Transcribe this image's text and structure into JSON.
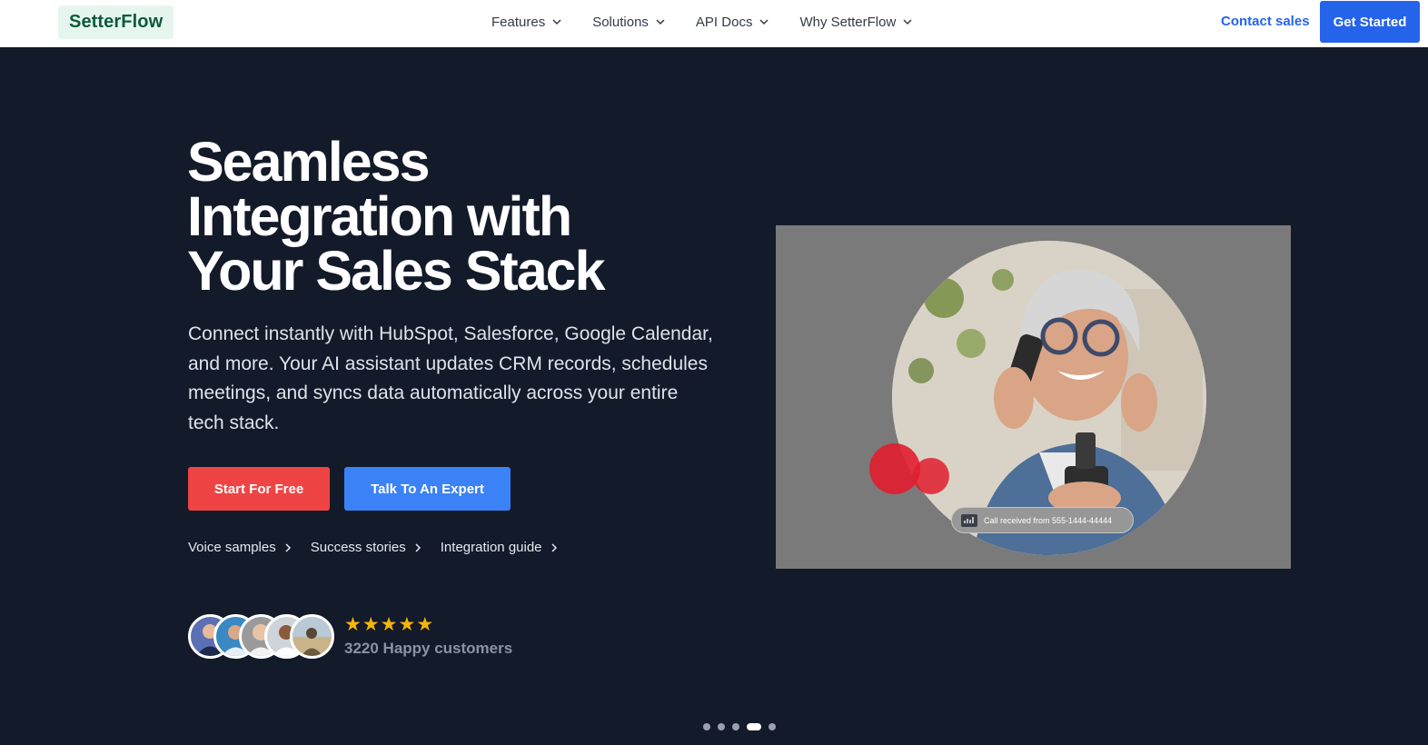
{
  "nav": {
    "logo": "SetterFlow",
    "menu": [
      {
        "label": "Features"
      },
      {
        "label": "Solutions"
      },
      {
        "label": "API Docs"
      },
      {
        "label": "Why SetterFlow"
      }
    ],
    "contact_label": "Contact sales",
    "cta_label": "Get Started"
  },
  "hero": {
    "headline_line1": "Seamless",
    "headline_line2": "Integration with",
    "headline_line3": "Your Sales Stack",
    "subtext": "Connect instantly with HubSpot, Salesforce, Google Calendar, and more. Your AI assistant updates CRM records, schedules meetings, and syncs data automatically across your entire tech stack.",
    "primary_button": "Start For Free",
    "secondary_button": "Talk To An Expert",
    "links": [
      {
        "label": "Voice samples"
      },
      {
        "label": "Success stories"
      },
      {
        "label": "Integration guide"
      }
    ],
    "rating": 5,
    "customers_label": "3220 Happy customers"
  },
  "media": {
    "call_badge": "Call received from 555-1444-44444"
  },
  "carousel": {
    "count": 5,
    "active_index": 3
  },
  "colors": {
    "background": "#131a2a",
    "accent_blue": "#2563eb",
    "button_red": "#ef4444",
    "button_blue": "#3b82f6",
    "star": "#f5b50a"
  }
}
